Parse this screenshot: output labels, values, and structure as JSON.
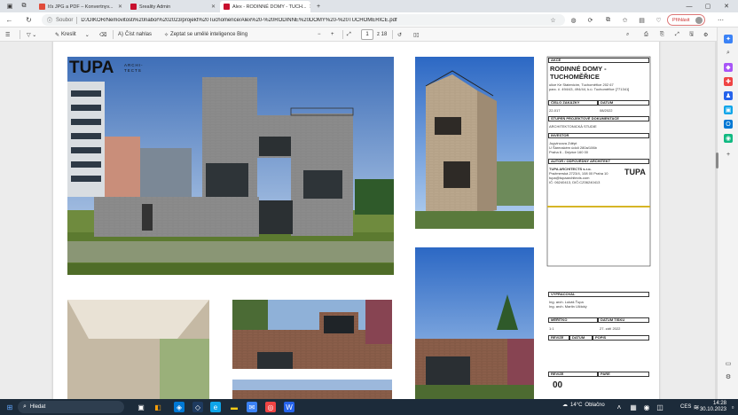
{
  "tabs": [
    {
      "title": "Iťs JPG a PDF – Konvertnyv...",
      "active": false
    },
    {
      "title": "Sreality Admin",
      "active": false
    },
    {
      "title": "Alex - RODINNÉ DOMY - TUCH...",
      "active": true
    }
  ],
  "address": {
    "security_label": "Soubor",
    "url": "D:/DIKOR/Nemovitosti%20nabor%202023/projekt%20Tuchomerice/Alex%20-%20RODINNÉ%20DOMY%20-%20TUCHOMĚŘICE.pdf",
    "signin_label": "Přihlásit"
  },
  "pdf_toolbar": {
    "draw_label": "Kreslit",
    "read_aloud_label": "Číst nahlas",
    "ask_ai_label": "Zeptat se umělé inteligence Bing",
    "zoom_out": "−",
    "zoom_in": "+",
    "page_number": "1",
    "page_total": "z 18"
  },
  "document": {
    "logo_text": "TUPA",
    "logo_sub": "ARCHI-\nTECTS",
    "title_block": {
      "akce_head": "AKCE",
      "project_title": "RODINNÉ DOMY - TUCHOMĚŘICE",
      "address_line1": "ulice Ke Statenicím, Tuchoměřice 202 67",
      "address_line2": "parc. č. 494/43, 494/44, k.ú. Tuchoměřice [771341]",
      "order_head": "ČÍSLO ZAKÁZKY",
      "date_head": "DATUM",
      "order_value": "22-017",
      "date_value": "08/2022",
      "stage_head": "STUPEŇ PROJEKTOVÉ DOKUMENTACE",
      "stage_value": "ARCHITEKTONICKÁ STUDIE",
      "investor_head": "INVESTOR",
      "investor_line1": "Jugvincova Zděpt",
      "investor_line2": "U Šárecském údolí 280a/106b",
      "investor_line3": "Praha 6 - Dejvice 160 00",
      "author_head": "AUTOR / ODPOVĚDNÝ ARCHITEKT",
      "author_name": "TUPA ARCHITECTS s.r.o.",
      "author_line1": "Pražmerská 2723/4, 108 00 Praha 10",
      "author_line2": "tupa@tupaarchitects.com",
      "author_line3": "IČ: 06240413, DIČ:CZ06240413",
      "author_logo": "TUPA",
      "prepared_head": "VYPRACOVAL",
      "prepared_line1": "Ing. arch. Lukáš Ťupa",
      "prepared_line2": "Ing. arch. Martin Ulčický",
      "scale_head": "MĚŘÍTKO",
      "print_date_head": "DATUM TISKU",
      "scale_value": "1:1",
      "print_date_value": "27. září 2022",
      "rev_head": "REVIZE",
      "rev_date_head": "DATUM",
      "rev_note_head": "POPIS",
      "rev_head2": "REVIZE",
      "page_head": "PARE",
      "rev_value": "00"
    }
  },
  "taskbar": {
    "search_placeholder": "Hledat",
    "weather_temp": "14°C",
    "weather_text": "Oblačno",
    "language": "CES",
    "time": "14:28",
    "date": "30.10.2023"
  },
  "colors": {
    "taskbar": "#1c2b3a",
    "accent": "#0067c0",
    "brick": "#8a5e4a"
  }
}
